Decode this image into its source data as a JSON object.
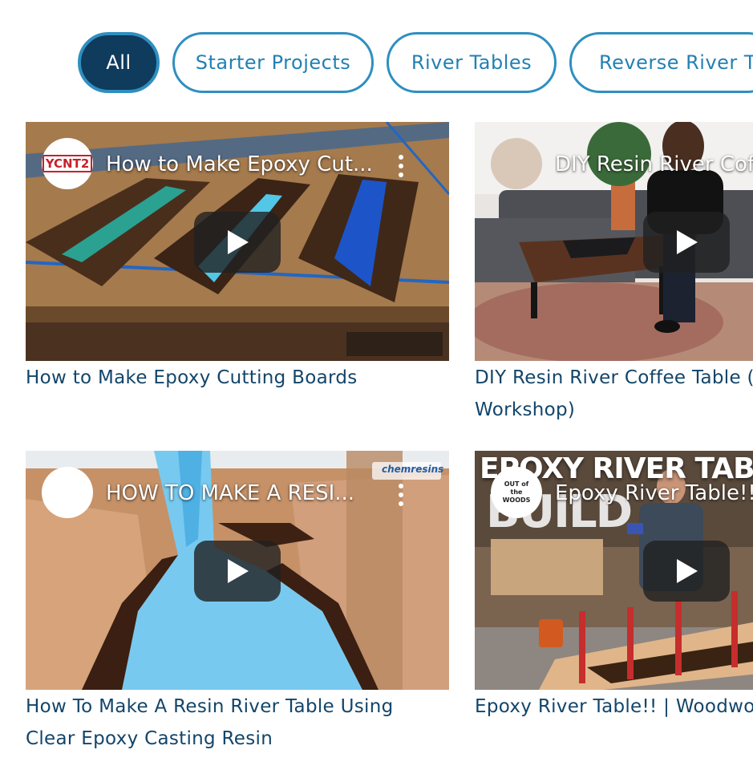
{
  "filters": [
    {
      "label": "All",
      "active": true
    },
    {
      "label": "Starter Projects",
      "active": false
    },
    {
      "label": "River Tables",
      "active": false
    },
    {
      "label": "Reverse River Ta",
      "active": false
    }
  ],
  "videos": [
    {
      "overlay_title": "How to Make Epoxy Cut...",
      "channel_logo_text": "YCNT2",
      "caption_lines": [
        "How to Make Epoxy Cutting Boards"
      ]
    },
    {
      "overlay_title": "DIY Resin River Cof",
      "caption_lines": [
        "DIY Resin River Coffee Table (",
        "Workshop)"
      ]
    },
    {
      "overlay_title": "HOW TO MAKE A RESI...",
      "watermark_text": "chemresins",
      "caption_lines": [
        "How To Make A Resin River Table Using",
        "Clear Epoxy Casting Resin"
      ]
    },
    {
      "overlay_title": "Epoxy River Table!!",
      "background_text": "EPOXY RIVER TABLE",
      "background_subtext": "BUILD",
      "channel_logo_text": "OUT of the WOODS",
      "caption_lines": [
        "Epoxy River Table!! | Woodwor"
      ]
    }
  ],
  "colors": {
    "active_pill_bg": "#0f3b5c",
    "pill_border": "#2f8fc0",
    "pill_text": "#2380b3",
    "caption_text": "#12456a",
    "play_button_bg": "#212121"
  }
}
